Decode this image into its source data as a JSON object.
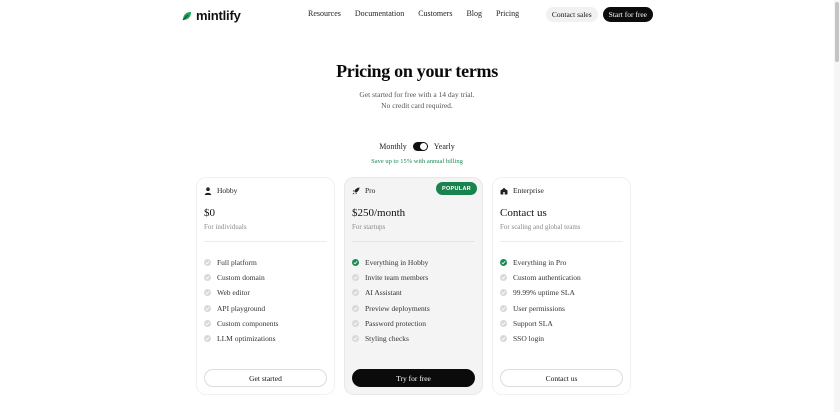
{
  "nav": {
    "logo": "mintlify",
    "links": [
      "Resources",
      "Documentation",
      "Customers",
      "Blog",
      "Pricing"
    ],
    "contact_sales": "Contact sales",
    "start_free": "Start for free"
  },
  "hero": {
    "title": "Pricing on your terms",
    "subtitle_line1": "Get started for free with a 14 day trial.",
    "subtitle_line2": "No credit card required."
  },
  "billing": {
    "monthly": "Monthly",
    "yearly": "Yearly",
    "save_note": "Save up to 15% with annual billing"
  },
  "colors": {
    "accent_green": "#1c8a58",
    "dark": "#0b0b0b"
  },
  "plans": [
    {
      "name": "Hobby",
      "icon": "user-icon",
      "price": "$0",
      "tagline": "For individuals",
      "features": [
        "Full platform",
        "Custom domain",
        "Web editor",
        "API playground",
        "Custom components",
        "LLM optimizations"
      ],
      "cta": "Get started"
    },
    {
      "name": "Pro",
      "icon": "rocket-icon",
      "badge": "POPULAR",
      "price": "$250/month",
      "tagline": "For startups",
      "features": [
        "Everything in Hobby",
        "Invite team members",
        "AI Assistant",
        "Preview deployments",
        "Password protection",
        "Styling checks"
      ],
      "cta": "Try for free"
    },
    {
      "name": "Enterprise",
      "icon": "building-icon",
      "price": "Contact us",
      "tagline": "For scaling and global teams",
      "features": [
        "Everything in Pro",
        "Custom authentication",
        "99.99% uptime SLA",
        "User permissions",
        "Support SLA",
        "SSO login"
      ],
      "cta": "Contact us"
    }
  ]
}
